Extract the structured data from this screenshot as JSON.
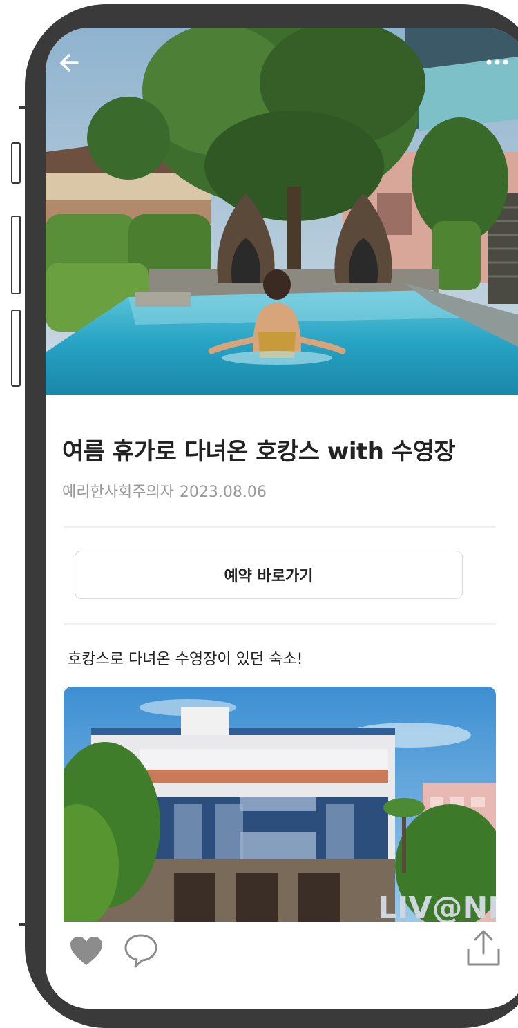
{
  "post": {
    "title": "여름 휴가로 다녀온 호캉스 with 수영장",
    "author": "예리한사회주의자",
    "date": "2023.08.06",
    "reserve_button_label": "예약 바로가기",
    "body_text": "호캉스로 다녀온 수영장이 있던 숙소!",
    "hero_image_alt": "호텔 수영장",
    "content_image_alt": "숙소 건물",
    "building_sign": "LIV@NIN"
  },
  "icons": {
    "back": "back-arrow-icon",
    "more": "more-dots-icon",
    "like": "heart-icon",
    "comment": "comment-icon",
    "share": "share-icon"
  },
  "colors": {
    "frame": "#3a3a3a",
    "title": "#222222",
    "meta": "#9a9a9a",
    "heart": "#8c8c8c",
    "pool": "#27a3c4"
  }
}
